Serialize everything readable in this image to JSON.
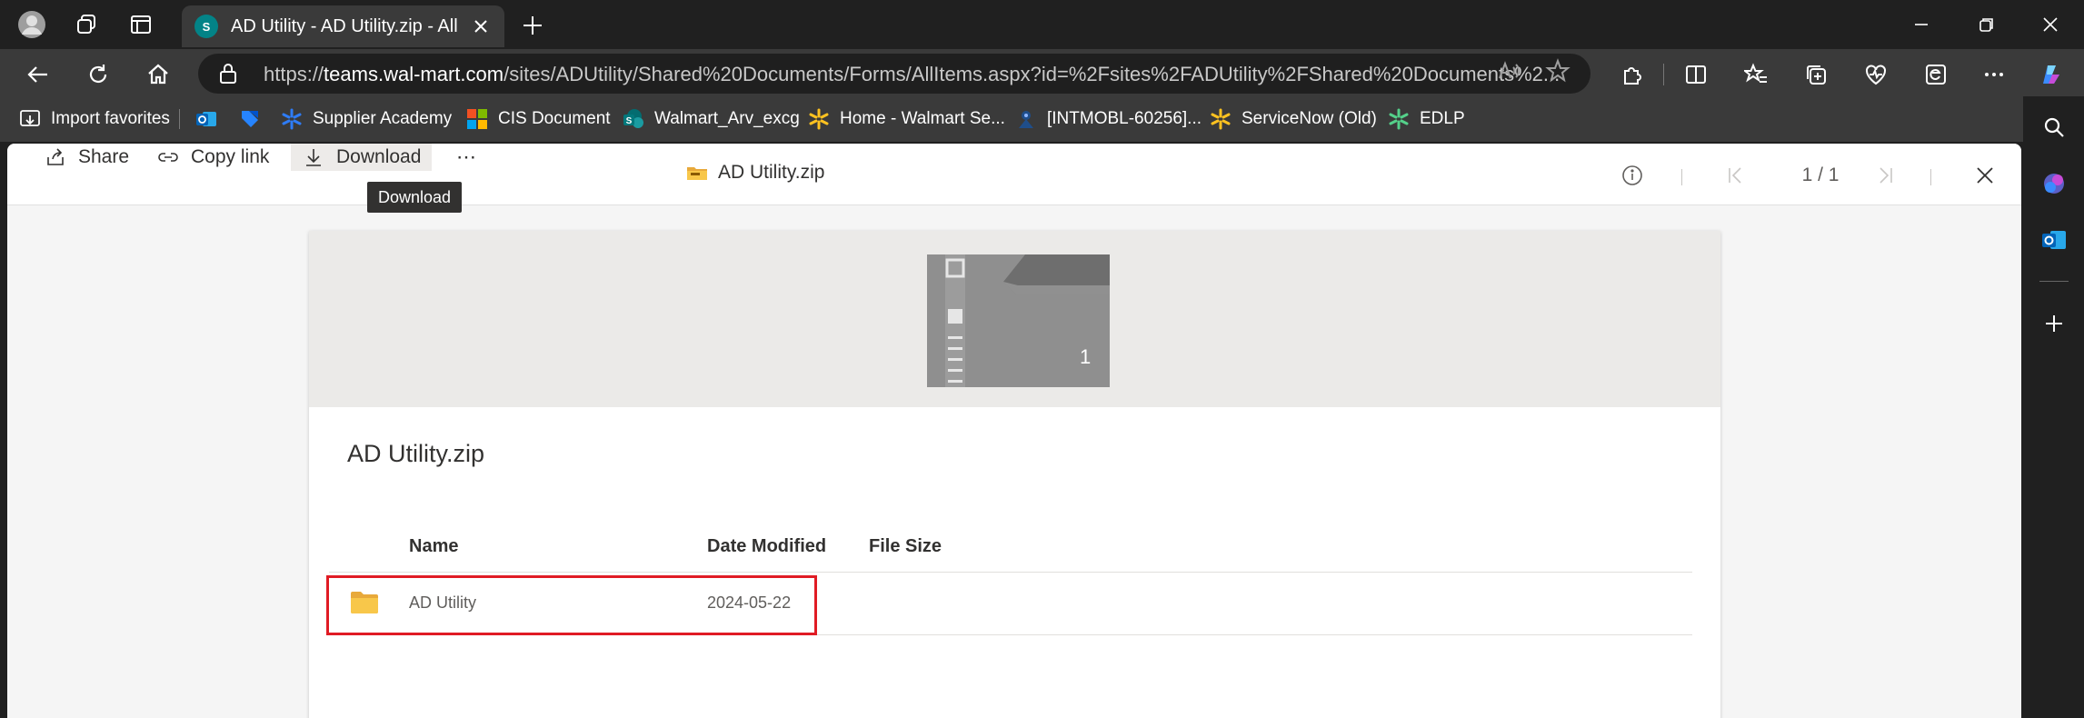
{
  "browser": {
    "active_tab": {
      "favicon_text": "S",
      "title": "AD Utility - AD Utility.zip - All Do"
    },
    "address": {
      "url_prefix": "https://",
      "url_host": "teams.wal-mart.com",
      "url_path": "/sites/ADUtility/Shared%20Documents/Forms/AllItems.aspx?id=%2Fsites%2FADUtility%2FShared%20Documents%2..."
    },
    "favorites": [
      {
        "label": "Import favorites",
        "icon": "import-icon"
      },
      {
        "label": "",
        "icon": "outlook-icon"
      },
      {
        "label": "",
        "icon": "jira-icon"
      },
      {
        "label": "Supplier Academy",
        "icon": "walmart-spark-icon"
      },
      {
        "label": "CIS Document",
        "icon": "microsoft-icon"
      },
      {
        "label": "Walmart_Arv_excg",
        "icon": "sharepoint-icon"
      },
      {
        "label": "Home - Walmart Se...",
        "icon": "walmart-spark-icon"
      },
      {
        "label": "[INTMOBL-60256]...",
        "icon": "jira-icon"
      },
      {
        "label": "ServiceNow (Old)",
        "icon": "walmart-spark-icon"
      },
      {
        "label": "EDLP",
        "icon": "walmart-spark-icon"
      }
    ]
  },
  "viewer": {
    "commands": {
      "share": "Share",
      "copy_link": "Copy link",
      "download": "Download",
      "more": "⋯"
    },
    "tooltip": "Download",
    "file_name": "AD Utility.zip",
    "pager": "1 / 1",
    "zip_item_count": "1",
    "card_title": "AD Utility.zip",
    "columns": [
      "Name",
      "Date Modified",
      "File Size"
    ],
    "rows": [
      {
        "name": "AD Utility",
        "date_modified": "2024-05-22",
        "file_size": ""
      }
    ],
    "colors": {
      "accent_highlight": "#e01b24",
      "folder": "#f8c74a",
      "sharepoint": "#038387"
    }
  }
}
